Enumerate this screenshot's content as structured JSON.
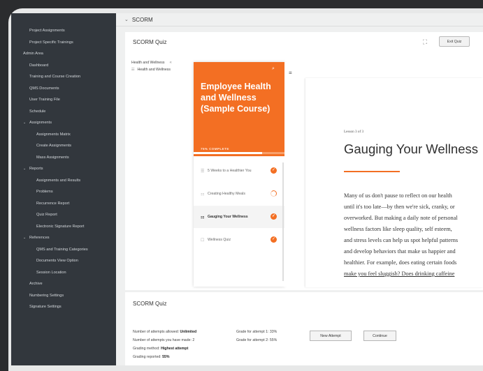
{
  "sidebar": {
    "items": [
      {
        "label": "Project Assignments",
        "indent": 1,
        "chevron": false
      },
      {
        "label": "Project Specific Trainings",
        "indent": 1,
        "chevron": false
      },
      {
        "label": "Admin Area",
        "indent": 0,
        "chevron": false
      },
      {
        "label": "Dashboard",
        "indent": 1,
        "chevron": false
      },
      {
        "label": "Training and Course Creation",
        "indent": 1,
        "chevron": false
      },
      {
        "label": "QMS Documents",
        "indent": 1,
        "chevron": false
      },
      {
        "label": "User Training File",
        "indent": 1,
        "chevron": false
      },
      {
        "label": "Schedule",
        "indent": 1,
        "chevron": false
      },
      {
        "label": "Assignments",
        "indent": 0,
        "chevron": true
      },
      {
        "label": "Assignments Matrix",
        "indent": 2,
        "chevron": false
      },
      {
        "label": "Create Assignments",
        "indent": 2,
        "chevron": false
      },
      {
        "label": "Mass Assignments",
        "indent": 2,
        "chevron": false
      },
      {
        "label": "Reports",
        "indent": 0,
        "chevron": true
      },
      {
        "label": "Assignments and Results",
        "indent": 2,
        "chevron": false
      },
      {
        "label": "Problems",
        "indent": 2,
        "chevron": false
      },
      {
        "label": "Recurrence Report",
        "indent": 2,
        "chevron": false
      },
      {
        "label": "Quiz Report",
        "indent": 2,
        "chevron": false
      },
      {
        "label": "Electronic Signature Report",
        "indent": 2,
        "chevron": false
      },
      {
        "label": "References",
        "indent": 0,
        "chevron": true
      },
      {
        "label": "QMS and Training Categories",
        "indent": 2,
        "chevron": false
      },
      {
        "label": "Documents View Option",
        "indent": 2,
        "chevron": false
      },
      {
        "label": "Session Location",
        "indent": 2,
        "chevron": false
      },
      {
        "label": "Archive",
        "indent": 1,
        "chevron": false
      },
      {
        "label": "Numbering Settings",
        "indent": 1,
        "chevron": false
      },
      {
        "label": "Signature Settings",
        "indent": 1,
        "chevron": false
      }
    ]
  },
  "section": {
    "chevron": "⌄",
    "title": "SCORM"
  },
  "quiz": {
    "title": "SCORM Quiz",
    "exit_label": "Exit Quiz",
    "expand_icon": "expand-icon",
    "tree": {
      "root": "Health and Wellness",
      "collapse_icon": "«",
      "child": "Health and Wellness",
      "child_icon": "☷"
    },
    "course": {
      "title": "Employee Health and Wellness (Sample Course)",
      "progress_label": "75% COMPLETE",
      "progress": 0.75,
      "lessons": [
        {
          "icon": "☰",
          "title": "5 Weeks to a Healthier You",
          "status": "done",
          "active": false
        },
        {
          "icon": "⚏",
          "title": "Creating Healthy Meals",
          "status": "partial",
          "active": false
        },
        {
          "icon": "⚏",
          "title": "Gauging Your Wellness",
          "status": "done",
          "active": true
        },
        {
          "icon": "☐",
          "title": "Wellness Quiz",
          "status": "done",
          "active": false
        }
      ],
      "accent": "#f36f23"
    },
    "lesson": {
      "menu_icon": "≡",
      "count": "Lesson 3 of 3",
      "heading": "Gauging Your Wellness",
      "lines": [
        "Many of us don't pause to reflect on our health",
        "until it's too late—by then we're sick, cranky, or",
        "overworked. But making a daily note of personal",
        "wellness factors like sleep quality, self esteem,",
        "and stress levels can help us spot helpful patterns",
        "and develop behaviors that make us happier and",
        "healthier. For example, does eating certain foods",
        "make you feel sluggish? Does drinking caffeine"
      ]
    }
  },
  "bottom": {
    "title": "SCORM Quiz",
    "attempts_allowed_label": "Number of attempts allowed:",
    "attempts_allowed_value": "Unlimited",
    "attempts_made_label": "Number of attempts you have made:",
    "attempts_made_value": "2",
    "grading_method_label": "Grading method:",
    "grading_method_value": "Highest attempt",
    "grade_reported_label": "Grading reported:",
    "grade_reported_value": "55%",
    "grade1_label": "Grade for attempt 1:",
    "grade1_value": "33%",
    "grade2_label": "Grade for attempt 2:",
    "grade2_value": "55%",
    "new_attempt_label": "New Attempt",
    "continue_label": "Continue"
  }
}
